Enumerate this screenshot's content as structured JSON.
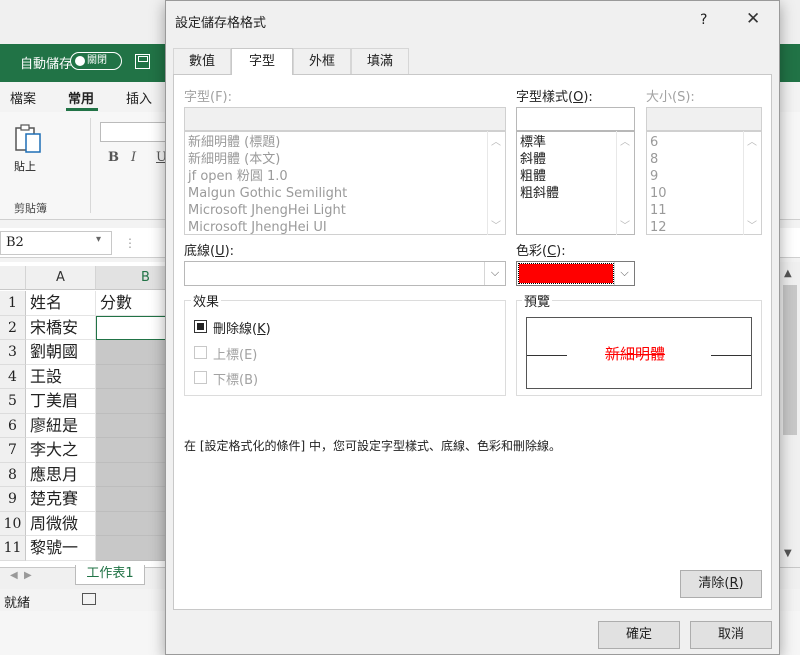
{
  "excel": {
    "autosave_label": "自動儲存",
    "autosave_state": "關閉",
    "ribbon_tabs": [
      "檔案",
      "常用",
      "插入"
    ],
    "paste_label": "貼上",
    "clipboard_group": "剪貼簿",
    "format_buttons": [
      "B",
      "I",
      "U"
    ],
    "namebox": "B2",
    "columns": [
      "A",
      "B"
    ],
    "rows": [
      {
        "n": "1",
        "a": "姓名",
        "b": "分數"
      },
      {
        "n": "2",
        "a": "宋橋安",
        "b": ""
      },
      {
        "n": "3",
        "a": "劉朝國",
        "b": ""
      },
      {
        "n": "4",
        "a": "王設",
        "b": ""
      },
      {
        "n": "5",
        "a": "丁美眉",
        "b": ""
      },
      {
        "n": "6",
        "a": "廖紐是",
        "b": ""
      },
      {
        "n": "7",
        "a": "李大之",
        "b": ""
      },
      {
        "n": "8",
        "a": "應思月",
        "b": ""
      },
      {
        "n": "9",
        "a": "楚克賽",
        "b": ""
      },
      {
        "n": "10",
        "a": "周微微",
        "b": ""
      },
      {
        "n": "11",
        "a": "黎號一",
        "b": ""
      }
    ],
    "sheet_tab": "工作表1",
    "status": "就緒"
  },
  "dialog": {
    "title": "設定儲存格格式",
    "help": "?",
    "close": "✕",
    "tabs": [
      "數值",
      "字型",
      "外框",
      "填滿"
    ],
    "active_tab": "字型",
    "font_label": "字型(F):",
    "style_label_prefix": "字型樣式(",
    "style_label_key": "O",
    "style_label_suffix": "):",
    "size_label": "大小(S):",
    "font_list": [
      "新細明體 (標題)",
      "新細明體 (本文)",
      "jf open 粉圓 1.0",
      "Malgun Gothic Semilight",
      "Microsoft JhengHei Light",
      "Microsoft JhengHei UI"
    ],
    "style_list": [
      "標準",
      "斜體",
      "粗體",
      "粗斜體"
    ],
    "size_list": [
      "6",
      "8",
      "9",
      "10",
      "11",
      "12"
    ],
    "underline_label_prefix": "底線(",
    "underline_label_key": "U",
    "underline_label_suffix": "):",
    "color_label_prefix": "色彩(",
    "color_label_key": "C",
    "color_label_suffix": "):",
    "color_value": "#ff0000",
    "effects_title": "效果",
    "strikethrough_prefix": "刪除線(",
    "strikethrough_key": "K",
    "strikethrough_suffix": ")",
    "strikethrough_checked": true,
    "superscript_label": "上標(E)",
    "subscript_label": "下標(B)",
    "preview_title": "預覽",
    "preview_text": "新細明體",
    "info_text": "在 [設定格式化的條件] 中，您可設定字型樣式、底線、色彩和刪除線。",
    "clear_prefix": "清除(",
    "clear_key": "R",
    "clear_suffix": ")",
    "ok_label": "確定",
    "cancel_label": "取消"
  }
}
